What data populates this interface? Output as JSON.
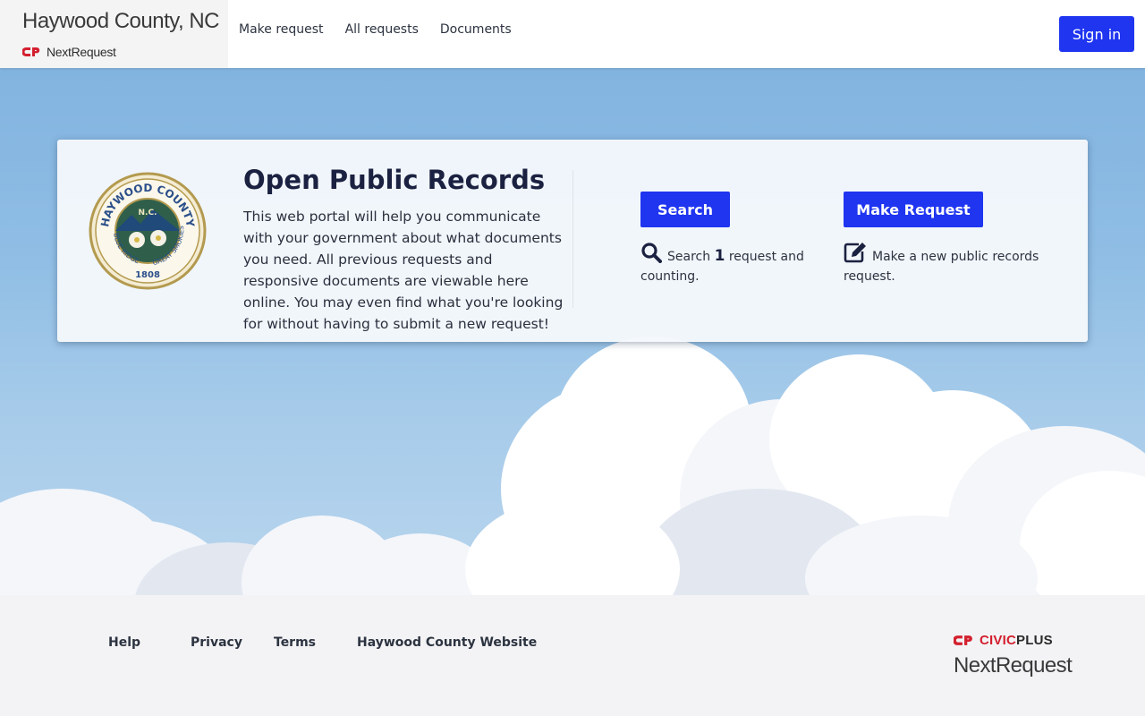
{
  "header": {
    "org_name": "Haywood County, NC",
    "product_name": "NextRequest",
    "nav": [
      {
        "label": "Make request"
      },
      {
        "label": "All requests"
      },
      {
        "label": "Documents"
      }
    ],
    "sign_in_label": "Sign in"
  },
  "hero": {
    "seal": {
      "top_text": "HAYWOOD COUNTY",
      "state": "N.C.",
      "left_text": "BLUE RIDGE",
      "right_text": "GREAT SMOKIES",
      "year": "1808"
    },
    "title": "Open Public Records",
    "description": "This web portal will help you communicate with your government about what documents you need. All previous requests and responsive documents are viewable here online. You may even find what you're looking for without having to submit a new request!",
    "search": {
      "button_label": "Search",
      "note_prefix": "Search",
      "count": "1",
      "note_suffix": "request and counting.",
      "icon": "search-icon"
    },
    "make_request": {
      "button_label": "Make Request",
      "note": "Make a new public records request.",
      "icon": "edit-icon"
    }
  },
  "footer": {
    "links": [
      {
        "label": "Help"
      },
      {
        "label": "Privacy"
      },
      {
        "label": "Terms"
      },
      {
        "label": "Haywood County Website"
      }
    ],
    "brand_name": "CIVICPLUS",
    "brand_product": "NextRequest"
  },
  "colors": {
    "primary_button": "#1f35f0",
    "brand_red": "#d3202f",
    "title_text": "#1b2140",
    "sky": "#82b4e0",
    "footer_bg": "#f3f3f5"
  }
}
